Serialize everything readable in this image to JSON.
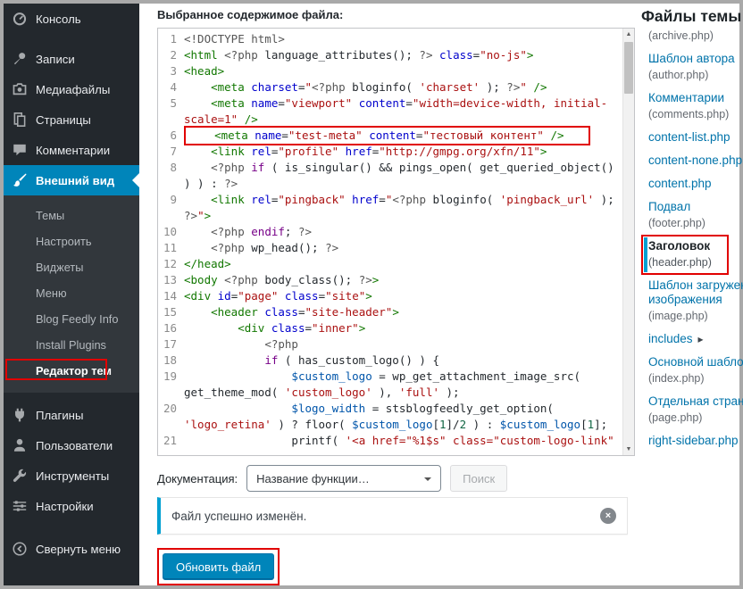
{
  "colors": {
    "menu_active": "#0085ba",
    "link": "#0073aa",
    "notice_accent": "#00a0d2",
    "annotation": "#e10000",
    "button_primary": "#0085ba"
  },
  "sidebar": {
    "top_items": [
      {
        "id": "dashboard",
        "icon": "dashboard-icon",
        "label": "Консоль"
      },
      {
        "id": "posts",
        "icon": "pin-icon",
        "label": "Записи"
      },
      {
        "id": "media",
        "icon": "camera-icon",
        "label": "Медиафайлы"
      },
      {
        "id": "pages",
        "icon": "pages-icon",
        "label": "Страницы"
      },
      {
        "id": "comments",
        "icon": "comment-icon",
        "label": "Комментарии"
      },
      {
        "id": "appearance",
        "icon": "brush-icon",
        "label": "Внешний вид",
        "active": true
      }
    ],
    "submenu": [
      {
        "id": "themes",
        "label": "Темы"
      },
      {
        "id": "customize",
        "label": "Настроить"
      },
      {
        "id": "widgets",
        "label": "Виджеты"
      },
      {
        "id": "menus",
        "label": "Меню"
      },
      {
        "id": "blog-feedly-info",
        "label": "Blog Feedly Info"
      },
      {
        "id": "install-plugins",
        "label": "Install Plugins"
      },
      {
        "id": "theme-editor",
        "label": "Редактор тем",
        "current": true,
        "annotated": true
      }
    ],
    "bottom_items": [
      {
        "id": "plugins",
        "icon": "plug-icon",
        "label": "Плагины"
      },
      {
        "id": "users",
        "icon": "user-icon",
        "label": "Пользователи"
      },
      {
        "id": "tools",
        "icon": "wrench-icon",
        "label": "Инструменты"
      },
      {
        "id": "settings",
        "icon": "sliders-icon",
        "label": "Настройки"
      }
    ],
    "collapse": {
      "id": "collapse-menu",
      "icon": "collapse-icon",
      "label": "Свернуть меню"
    }
  },
  "editor": {
    "title": "Выбранное содержимое файла:",
    "lines": [
      {
        "n": 1,
        "s": [
          [
            "m",
            "<!DOCTYPE html>"
          ]
        ]
      },
      {
        "n": 2,
        "s": [
          [
            "t",
            "<html "
          ],
          [
            "m",
            "<?php"
          ],
          [
            "p",
            " language_attributes(); "
          ],
          [
            "m",
            "?>"
          ],
          [
            "p",
            " "
          ],
          [
            "a",
            "class"
          ],
          [
            "p",
            "="
          ],
          [
            "s",
            "\"no-js\""
          ],
          [
            "t",
            ">"
          ]
        ]
      },
      {
        "n": 3,
        "s": [
          [
            "t",
            "<head>"
          ]
        ]
      },
      {
        "n": 4,
        "s": [
          [
            "p",
            "    "
          ],
          [
            "t",
            "<meta "
          ],
          [
            "a",
            "charset"
          ],
          [
            "p",
            "="
          ],
          [
            "s",
            "\""
          ],
          [
            "m",
            "<?php"
          ],
          [
            "p",
            " bloginfo( "
          ],
          [
            "s",
            "'charset'"
          ],
          [
            "p",
            " ); "
          ],
          [
            "m",
            "?>"
          ],
          [
            "s",
            "\""
          ],
          [
            "p",
            " "
          ],
          [
            "t",
            "/>"
          ]
        ]
      },
      {
        "n": 5,
        "s": [
          [
            "p",
            "    "
          ],
          [
            "t",
            "<meta "
          ],
          [
            "a",
            "name"
          ],
          [
            "p",
            "="
          ],
          [
            "s",
            "\"viewport\""
          ],
          [
            "p",
            " "
          ],
          [
            "a",
            "content"
          ],
          [
            "p",
            "="
          ],
          [
            "s",
            "\"width=device-width, initial-scale=1\""
          ],
          [
            "p",
            " "
          ],
          [
            "t",
            "/>"
          ]
        ]
      },
      {
        "n": 6,
        "hl": true,
        "s": [
          [
            "p",
            "    "
          ],
          [
            "t",
            "<meta "
          ],
          [
            "a",
            "name"
          ],
          [
            "p",
            "="
          ],
          [
            "s",
            "\"test-meta\""
          ],
          [
            "p",
            " "
          ],
          [
            "a",
            "content"
          ],
          [
            "p",
            "="
          ],
          [
            "s",
            "\"тестовый контент\""
          ],
          [
            "p",
            " "
          ],
          [
            "t",
            "/>"
          ]
        ]
      },
      {
        "n": 7,
        "s": [
          [
            "p",
            "    "
          ],
          [
            "t",
            "<link "
          ],
          [
            "a",
            "rel"
          ],
          [
            "p",
            "="
          ],
          [
            "s",
            "\"profile\""
          ],
          [
            "p",
            " "
          ],
          [
            "a",
            "href"
          ],
          [
            "p",
            "="
          ],
          [
            "s",
            "\"http://gmpg.org/xfn/11\""
          ],
          [
            "t",
            ">"
          ]
        ]
      },
      {
        "n": 8,
        "s": [
          [
            "p",
            "    "
          ],
          [
            "m",
            "<?php"
          ],
          [
            "p",
            " "
          ],
          [
            "k",
            "if"
          ],
          [
            "p",
            " ( is_singular() && pings_open( get_queried_object() ) ) : "
          ],
          [
            "m",
            "?>"
          ]
        ]
      },
      {
        "n": 9,
        "s": [
          [
            "p",
            "    "
          ],
          [
            "t",
            "<link "
          ],
          [
            "a",
            "rel"
          ],
          [
            "p",
            "="
          ],
          [
            "s",
            "\"pingback\""
          ],
          [
            "p",
            " "
          ],
          [
            "a",
            "href"
          ],
          [
            "p",
            "="
          ],
          [
            "s",
            "\""
          ],
          [
            "m",
            "<?php"
          ],
          [
            "p",
            " bloginfo( "
          ],
          [
            "s",
            "'pingback_url'"
          ],
          [
            "p",
            " ); "
          ],
          [
            "m",
            "?>"
          ],
          [
            "s",
            "\""
          ],
          [
            "t",
            ">"
          ]
        ]
      },
      {
        "n": 10,
        "s": [
          [
            "p",
            "    "
          ],
          [
            "m",
            "<?php"
          ],
          [
            "p",
            " "
          ],
          [
            "k",
            "endif"
          ],
          [
            "p",
            "; "
          ],
          [
            "m",
            "?>"
          ]
        ]
      },
      {
        "n": 11,
        "s": [
          [
            "p",
            "    "
          ],
          [
            "m",
            "<?php"
          ],
          [
            "p",
            " wp_head(); "
          ],
          [
            "m",
            "?>"
          ]
        ]
      },
      {
        "n": 12,
        "s": [
          [
            "t",
            "</head>"
          ]
        ]
      },
      {
        "n": 13,
        "s": [
          [
            "t",
            "<body "
          ],
          [
            "m",
            "<?php"
          ],
          [
            "p",
            " body_class(); "
          ],
          [
            "m",
            "?>"
          ],
          [
            "t",
            ">"
          ]
        ]
      },
      {
        "n": 14,
        "s": [
          [
            "t",
            "<div "
          ],
          [
            "a",
            "id"
          ],
          [
            "p",
            "="
          ],
          [
            "s",
            "\"page\""
          ],
          [
            "p",
            " "
          ],
          [
            "a",
            "class"
          ],
          [
            "p",
            "="
          ],
          [
            "s",
            "\"site\""
          ],
          [
            "t",
            ">"
          ]
        ]
      },
      {
        "n": 15,
        "s": [
          [
            "p",
            "    "
          ],
          [
            "t",
            "<header "
          ],
          [
            "a",
            "class"
          ],
          [
            "p",
            "="
          ],
          [
            "s",
            "\"site-header\""
          ],
          [
            "t",
            ">"
          ]
        ]
      },
      {
        "n": 16,
        "s": [
          [
            "p",
            "        "
          ],
          [
            "t",
            "<div "
          ],
          [
            "a",
            "class"
          ],
          [
            "p",
            "="
          ],
          [
            "s",
            "\"inner\""
          ],
          [
            "t",
            ">"
          ]
        ]
      },
      {
        "n": 17,
        "s": [
          [
            "p",
            "            "
          ],
          [
            "m",
            "<?php"
          ]
        ]
      },
      {
        "n": 18,
        "s": [
          [
            "p",
            "            "
          ],
          [
            "k",
            "if"
          ],
          [
            "p",
            " ( has_custom_logo() ) {"
          ]
        ]
      },
      {
        "n": 19,
        "s": [
          [
            "p",
            "                "
          ],
          [
            "v",
            "$custom_logo"
          ],
          [
            "p",
            " = wp_get_attachment_image_src( get_theme_mod( "
          ],
          [
            "s",
            "'custom_logo'"
          ],
          [
            "p",
            " ), "
          ],
          [
            "s",
            "'full'"
          ],
          [
            "p",
            " );"
          ]
        ]
      },
      {
        "n": 20,
        "s": [
          [
            "p",
            "                "
          ],
          [
            "v",
            "$logo_width"
          ],
          [
            "p",
            " = stsblogfeedly_get_option( "
          ],
          [
            "s",
            "'logo_retina'"
          ],
          [
            "p",
            " ) ? floor( "
          ],
          [
            "v",
            "$custom_logo"
          ],
          [
            "p",
            "["
          ],
          [
            "n2",
            "1"
          ],
          [
            "p",
            "]/"
          ],
          [
            "n2",
            "2"
          ],
          [
            "p",
            " ) : "
          ],
          [
            "v",
            "$custom_logo"
          ],
          [
            "p",
            "["
          ],
          [
            "n2",
            "1"
          ],
          [
            "p",
            "];"
          ]
        ]
      },
      {
        "n": 21,
        "s": [
          [
            "p",
            "                printf( "
          ],
          [
            "s",
            "'<a href=\"%1$s\" class=\"custom-logo-link\""
          ]
        ]
      }
    ]
  },
  "docs": {
    "label": "Документация:",
    "select_value": "Название функции…",
    "search_button": "Поиск"
  },
  "notice": {
    "text": "Файл успешно изменён."
  },
  "update": {
    "label": "Обновить файл"
  },
  "files_panel": {
    "title": "Файлы темы",
    "files": [
      {
        "id": "archive",
        "label": "",
        "file": "(archive.php)"
      },
      {
        "id": "author",
        "label": "Шаблон автора",
        "file": "(author.php)"
      },
      {
        "id": "comments",
        "label": "Комментарии",
        "file": "(comments.php)"
      },
      {
        "id": "content-list",
        "label": "content-list.php",
        "file": ""
      },
      {
        "id": "content-none",
        "label": "content-none.php",
        "file": ""
      },
      {
        "id": "content",
        "label": "content.php",
        "file": ""
      },
      {
        "id": "footer",
        "label": "Подвал",
        "file": "(footer.php)"
      },
      {
        "id": "header",
        "label": "Заголовок",
        "file": "(header.php)",
        "selected": true,
        "annotated": true
      },
      {
        "id": "image",
        "label": "Шаблон загруженного изображения",
        "file": "(image.php)"
      },
      {
        "id": "includes",
        "label": "includes",
        "folder": true,
        "arrow": "▸"
      },
      {
        "id": "index",
        "label": "Основной шаблон",
        "file": "(index.php)"
      },
      {
        "id": "page",
        "label": "Отдельная страница",
        "file": "(page.php)"
      },
      {
        "id": "right-sidebar",
        "label": "right-sidebar.php",
        "file": ""
      }
    ]
  }
}
